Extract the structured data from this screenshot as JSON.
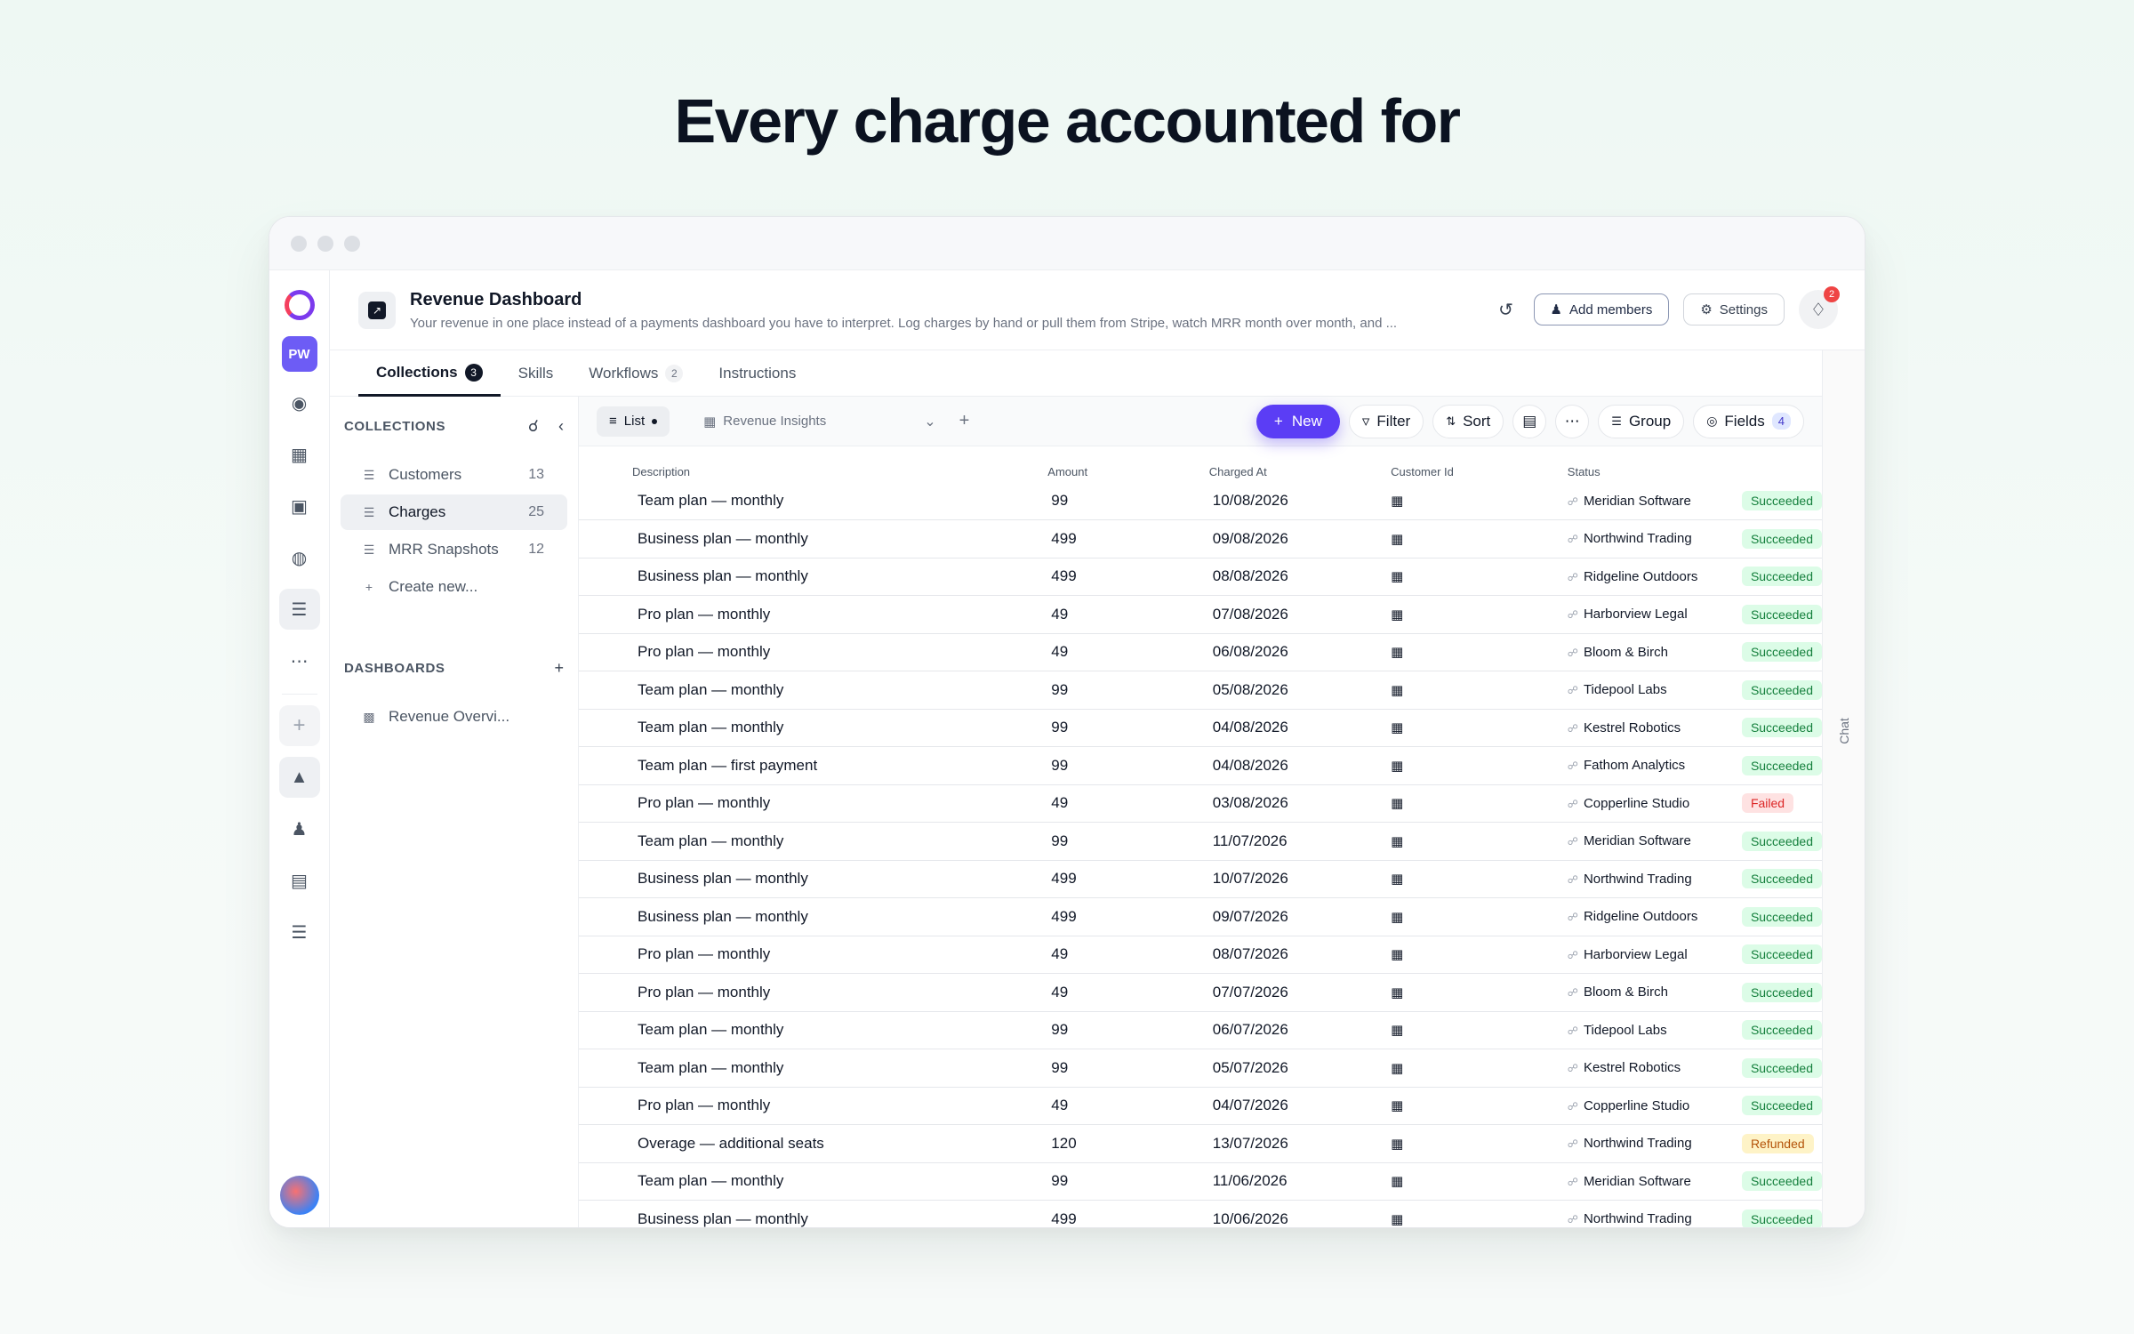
{
  "headline": "Every charge accounted for",
  "rail": {
    "workspace_initials": "PW"
  },
  "header": {
    "title": "Revenue Dashboard",
    "description": "Your revenue in one place instead of a payments dashboard you have to interpret. Log charges by hand or pull them from Stripe, watch MRR month over month, and ...",
    "add_members_label": "Add members",
    "settings_label": "Settings",
    "notification_count": "2"
  },
  "tabs": [
    {
      "label": "Collections",
      "count": "3"
    },
    {
      "label": "Skills",
      "count": ""
    },
    {
      "label": "Workflows",
      "count": "2"
    },
    {
      "label": "Instructions",
      "count": ""
    }
  ],
  "sidebar": {
    "collections_title": "COLLECTIONS",
    "items": [
      {
        "label": "Customers",
        "count": "13"
      },
      {
        "label": "Charges",
        "count": "25"
      },
      {
        "label": "MRR Snapshots",
        "count": "12"
      }
    ],
    "create_label": "Create new...",
    "dashboards_title": "DASHBOARDS",
    "dashboard_item": "Revenue Overvi..."
  },
  "toolbar": {
    "list_label": "List",
    "insights_label": "Revenue Insights",
    "new_label": "New",
    "filter_label": "Filter",
    "sort_label": "Sort",
    "group_label": "Group",
    "fields_label": "Fields",
    "fields_count": "4"
  },
  "chat_label": "Chat",
  "table": {
    "columns": [
      "Description",
      "Amount",
      "Charged At",
      "Customer Id",
      "Status"
    ],
    "rows": [
      {
        "desc": "Team plan — monthly",
        "amount": "99",
        "date": "10/08/2026",
        "customer": "Meridian Software",
        "status": "Succeeded"
      },
      {
        "desc": "Business plan — monthly",
        "amount": "499",
        "date": "09/08/2026",
        "customer": "Northwind Trading",
        "status": "Succeeded"
      },
      {
        "desc": "Business plan — monthly",
        "amount": "499",
        "date": "08/08/2026",
        "customer": "Ridgeline Outdoors",
        "status": "Succeeded"
      },
      {
        "desc": "Pro plan — monthly",
        "amount": "49",
        "date": "07/08/2026",
        "customer": "Harborview Legal",
        "status": "Succeeded"
      },
      {
        "desc": "Pro plan — monthly",
        "amount": "49",
        "date": "06/08/2026",
        "customer": "Bloom & Birch",
        "status": "Succeeded"
      },
      {
        "desc": "Team plan — monthly",
        "amount": "99",
        "date": "05/08/2026",
        "customer": "Tidepool Labs",
        "status": "Succeeded"
      },
      {
        "desc": "Team plan — monthly",
        "amount": "99",
        "date": "04/08/2026",
        "customer": "Kestrel Robotics",
        "status": "Succeeded"
      },
      {
        "desc": "Team plan — first payment",
        "amount": "99",
        "date": "04/08/2026",
        "customer": "Fathom Analytics",
        "status": "Succeeded"
      },
      {
        "desc": "Pro plan — monthly",
        "amount": "49",
        "date": "03/08/2026",
        "customer": "Copperline Studio",
        "status": "Failed"
      },
      {
        "desc": "Team plan — monthly",
        "amount": "99",
        "date": "11/07/2026",
        "customer": "Meridian Software",
        "status": "Succeeded"
      },
      {
        "desc": "Business plan — monthly",
        "amount": "499",
        "date": "10/07/2026",
        "customer": "Northwind Trading",
        "status": "Succeeded"
      },
      {
        "desc": "Business plan — monthly",
        "amount": "499",
        "date": "09/07/2026",
        "customer": "Ridgeline Outdoors",
        "status": "Succeeded"
      },
      {
        "desc": "Pro plan — monthly",
        "amount": "49",
        "date": "08/07/2026",
        "customer": "Harborview Legal",
        "status": "Succeeded"
      },
      {
        "desc": "Pro plan — monthly",
        "amount": "49",
        "date": "07/07/2026",
        "customer": "Bloom & Birch",
        "status": "Succeeded"
      },
      {
        "desc": "Team plan — monthly",
        "amount": "99",
        "date": "06/07/2026",
        "customer": "Tidepool Labs",
        "status": "Succeeded"
      },
      {
        "desc": "Team plan — monthly",
        "amount": "99",
        "date": "05/07/2026",
        "customer": "Kestrel Robotics",
        "status": "Succeeded"
      },
      {
        "desc": "Pro plan — monthly",
        "amount": "49",
        "date": "04/07/2026",
        "customer": "Copperline Studio",
        "status": "Succeeded"
      },
      {
        "desc": "Overage — additional seats",
        "amount": "120",
        "date": "13/07/2026",
        "customer": "Northwind Trading",
        "status": "Refunded"
      },
      {
        "desc": "Team plan — monthly",
        "amount": "99",
        "date": "11/06/2026",
        "customer": "Meridian Software",
        "status": "Succeeded"
      },
      {
        "desc": "Business plan — monthly",
        "amount": "499",
        "date": "10/06/2026",
        "customer": "Northwind Trading",
        "status": "Succeeded"
      }
    ]
  }
}
